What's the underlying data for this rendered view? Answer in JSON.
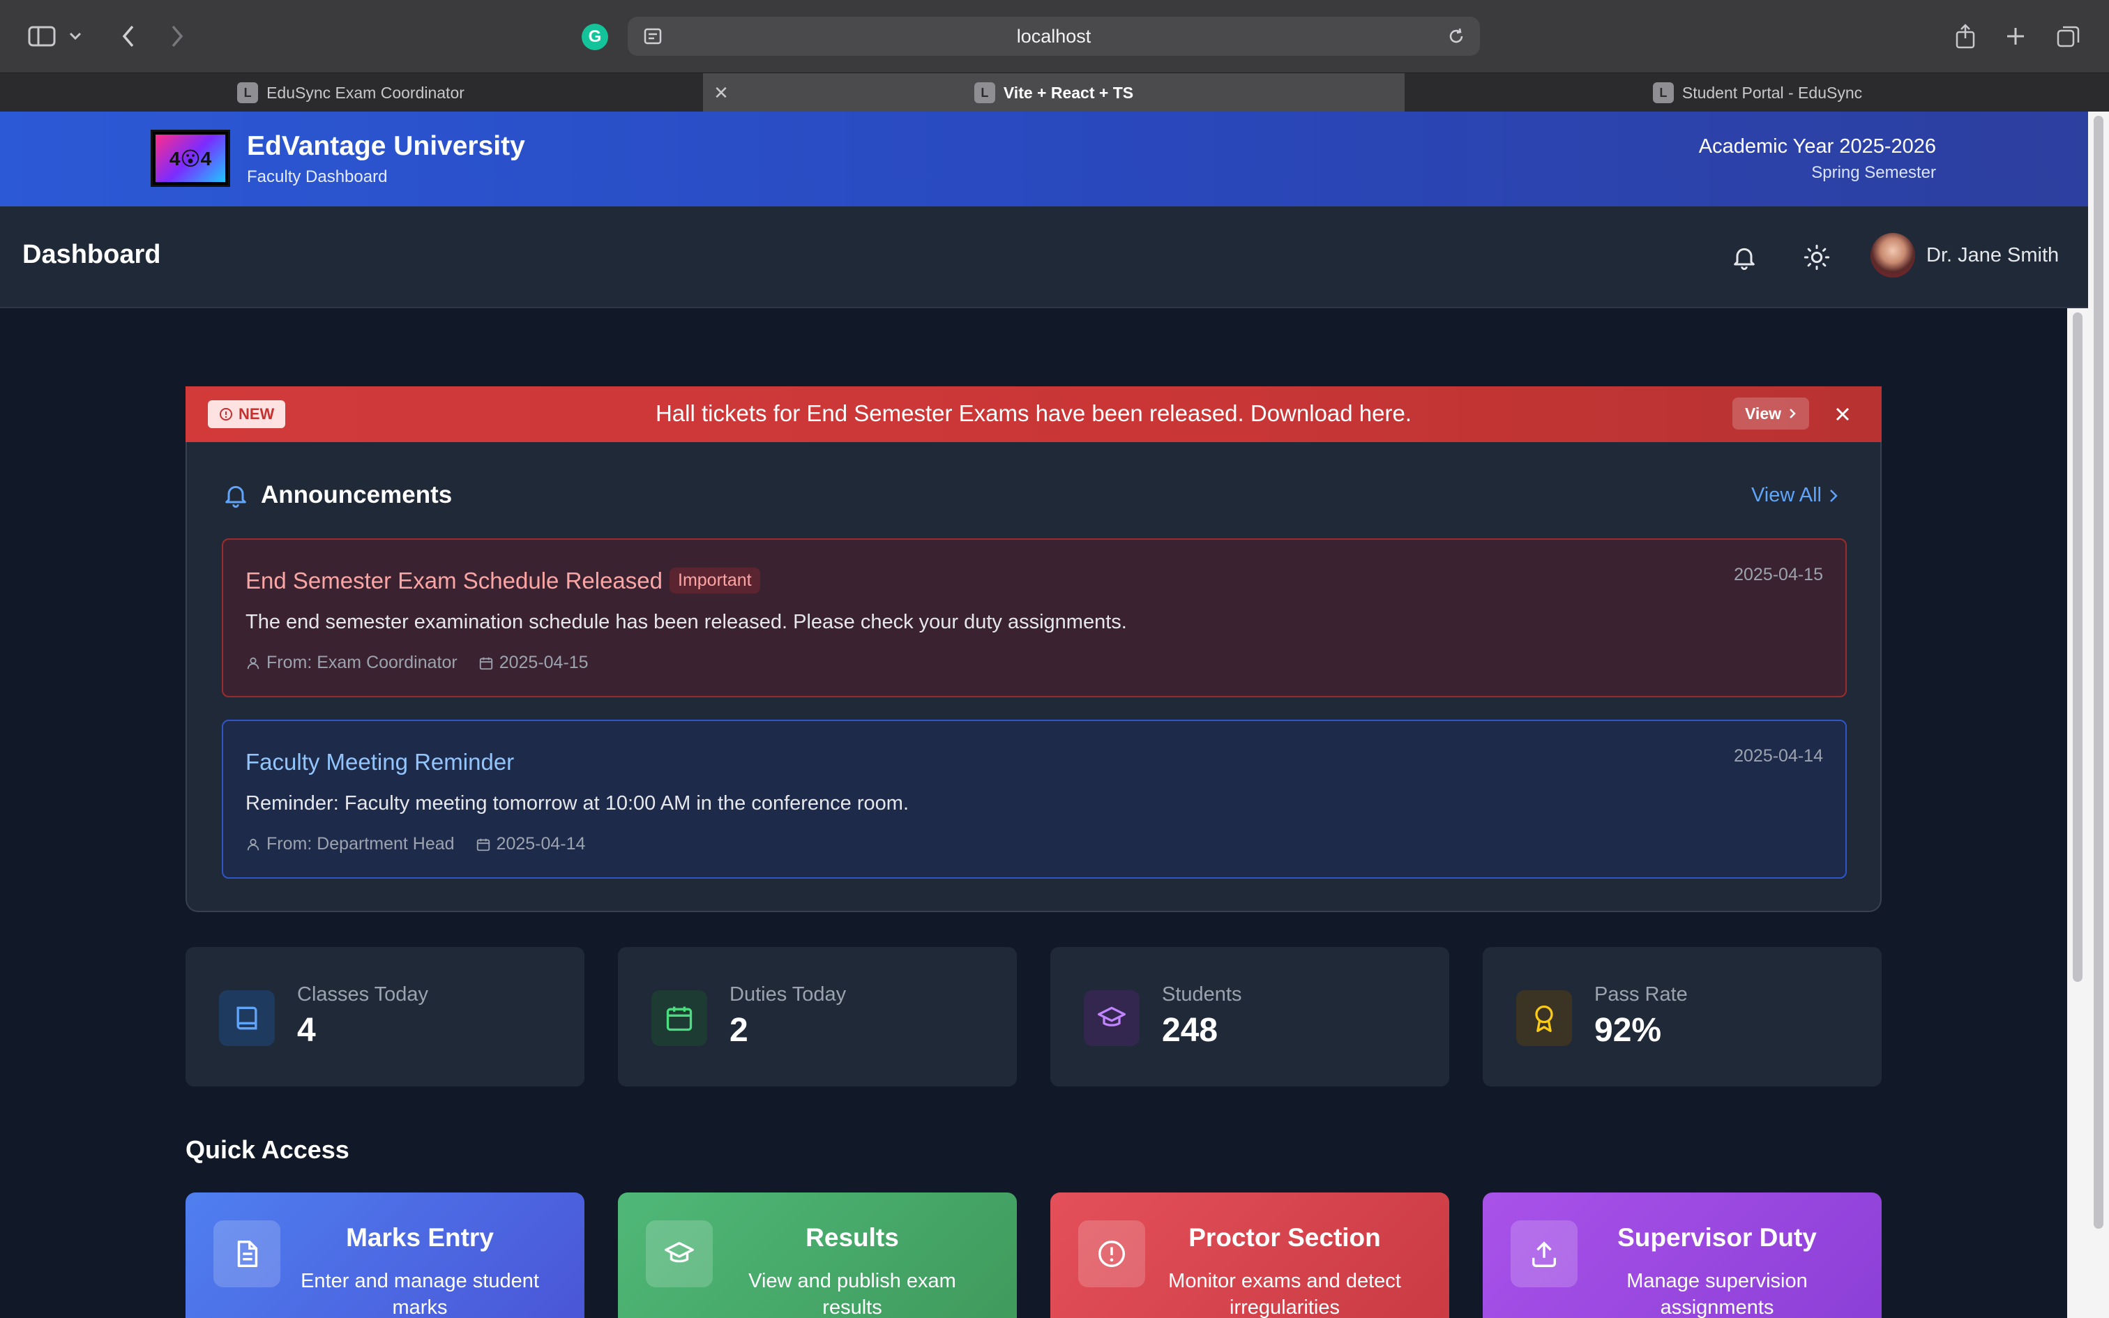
{
  "browser": {
    "url": "localhost",
    "tabs": [
      {
        "label": "EduSync Exam Coordinator",
        "favicon": "L"
      },
      {
        "label": "Vite + React + TS",
        "favicon": "L"
      },
      {
        "label": "Student Portal - EduSync",
        "favicon": "L"
      }
    ],
    "extension_badge": "G"
  },
  "header": {
    "logo_text": "4😮4",
    "university": "EdVantage University",
    "subtitle": "Faculty Dashboard",
    "academic_year": "Academic Year 2025-2026",
    "semester": "Spring Semester"
  },
  "topbar": {
    "title": "Dashboard",
    "user_name": "Dr. Jane Smith"
  },
  "alert": {
    "badge": "NEW",
    "message": "Hall tickets for End Semester Exams have been released. Download here.",
    "button": "View",
    "color": "#d23a3a"
  },
  "announcements": {
    "title": "Announcements",
    "view_all": "View All",
    "items": [
      {
        "title": "End Semester Exam Schedule Released",
        "badge": "Important",
        "date": "2025-04-15",
        "body": "The end semester examination schedule has been released. Please check your duty assignments.",
        "from": "From: Exam Coordinator",
        "meta_date": "2025-04-15"
      },
      {
        "title": "Faculty Meeting Reminder",
        "date": "2025-04-14",
        "body": "Reminder: Faculty meeting tomorrow at 10:00 AM in the conference room.",
        "from": "From: Department Head",
        "meta_date": "2025-04-14"
      }
    ]
  },
  "stats": [
    {
      "label": "Classes Today",
      "value": "4",
      "icon": "book-icon",
      "color": "#60a5fa"
    },
    {
      "label": "Duties Today",
      "value": "2",
      "icon": "calendar-icon",
      "color": "#4ade80"
    },
    {
      "label": "Students",
      "value": "248",
      "icon": "graduation-cap-icon",
      "color": "#c084fc"
    },
    {
      "label": "Pass Rate",
      "value": "92%",
      "icon": "award-icon",
      "color": "#facc15"
    }
  ],
  "quick_access": {
    "heading": "Quick Access",
    "items": [
      {
        "title": "Marks Entry",
        "desc": "Enter and manage student marks",
        "icon": "document-icon",
        "color": "#4f6ee8"
      },
      {
        "title": "Results",
        "desc": "View and publish exam results",
        "icon": "graduation-cap-icon",
        "color": "#48b06a"
      },
      {
        "title": "Proctor Section",
        "desc": "Monitor exams and detect irregularities",
        "icon": "alert-circle-icon",
        "color": "#dc4a52"
      },
      {
        "title": "Supervisor Duty",
        "desc": "Manage supervision assignments",
        "icon": "upload-icon",
        "color": "#a24ee6"
      }
    ]
  }
}
